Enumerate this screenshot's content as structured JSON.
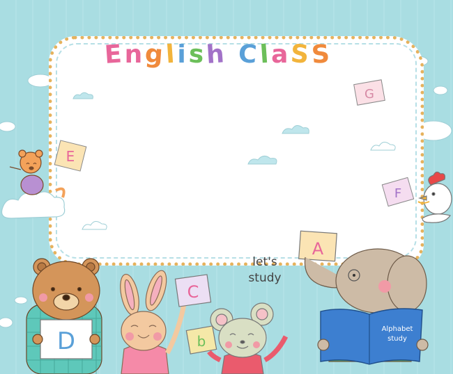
{
  "title": {
    "letters": [
      {
        "ch": "E",
        "color": "#e8669a"
      },
      {
        "ch": "n",
        "color": "#e8669a"
      },
      {
        "ch": "g",
        "color": "#f08a3c"
      },
      {
        "ch": "l",
        "color": "#f2b43c"
      },
      {
        "ch": "i",
        "color": "#5aa0d8"
      },
      {
        "ch": "s",
        "color": "#6cbf5a"
      },
      {
        "ch": "h",
        "color": "#a272c8"
      },
      {
        "ch": " ",
        "color": "#ffffff"
      },
      {
        "ch": "C",
        "color": "#5aa0d8"
      },
      {
        "ch": "l",
        "color": "#6cbf5a"
      },
      {
        "ch": "a",
        "color": "#e8669a"
      },
      {
        "ch": "S",
        "color": "#f2b43c"
      },
      {
        "ch": "S",
        "color": "#f08a3c"
      }
    ]
  },
  "subtitle": {
    "line1": "let's",
    "line2": "study"
  },
  "cards": {
    "a": "A",
    "b": "b",
    "c": "C",
    "d": "D",
    "e": "E",
    "f": "F",
    "g": "G"
  },
  "book": {
    "line1": "Alphabet",
    "line2": "study"
  },
  "colors": {
    "background": "#a9dde2",
    "board_border": "#e6b25d",
    "bear": "#d4955a",
    "rabbit": "#f3c9a0",
    "mouse": "#d9dfc4",
    "elephant": "#cdbba6",
    "book": "#3d7fd0"
  }
}
